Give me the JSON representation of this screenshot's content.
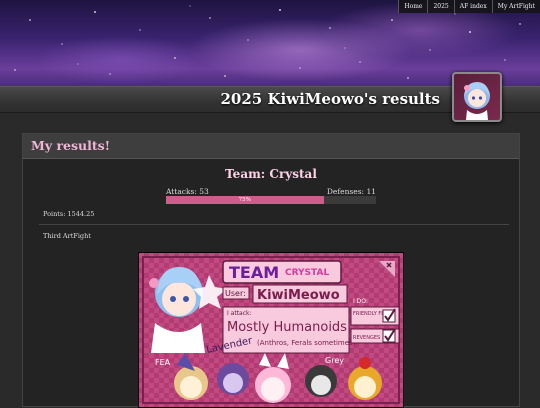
{
  "nav": {
    "items": [
      "Home",
      "2025",
      "AF index",
      "My ArtFight"
    ]
  },
  "header": {
    "title": "2025 KiwiMeowo's results"
  },
  "results": {
    "heading": "My results!",
    "team_line": "Team: Crystal",
    "attacks": "Attacks: 53",
    "defenses": "Defenses: 11",
    "progress_label": "75%",
    "progress_fraction": 0.75,
    "points": "Points: 1544.25",
    "participation": "Third ArtFight"
  },
  "badge": {
    "team_word": "TEAM",
    "team_name": "CRYSTAL",
    "user_label": "User:",
    "user_name": "KiwiMeowo",
    "attack_label": "I attack:",
    "attack_value": "Mostly Humanoids",
    "attack_note": "(Anthros, Ferals sometimes)",
    "i_do_label": "I DO:",
    "friendly_fire": "FRIENDLY FIRE",
    "revenge": "REVENGES",
    "bottom_label": "FEA",
    "tag_lavender": "Lavender",
    "tag_grey": "Grey"
  },
  "colors": {
    "accent_pink": "#cf5d8b",
    "heading_pink": "#f1b6d6",
    "badge_bg": "#b23b72"
  }
}
